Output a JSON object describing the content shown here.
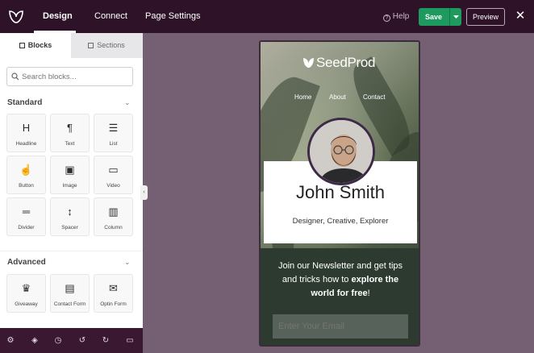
{
  "topbar": {
    "tabs": [
      "Design",
      "Connect",
      "Page Settings"
    ],
    "help_label": "Help",
    "save_label": "Save",
    "preview_label": "Preview",
    "close_glyph": "✕"
  },
  "sidebar": {
    "tabs": [
      "Blocks",
      "Sections"
    ],
    "search_placeholder": "Search blocks...",
    "standard_title": "Standard",
    "advanced_title": "Advanced",
    "standard_blocks": [
      {
        "label": "Headline",
        "icon": "headline-icon",
        "glyph": "H"
      },
      {
        "label": "Text",
        "icon": "paragraph-icon",
        "glyph": "¶"
      },
      {
        "label": "List",
        "icon": "list-icon",
        "glyph": "☰"
      },
      {
        "label": "Button",
        "icon": "pointer-icon",
        "glyph": "☝"
      },
      {
        "label": "Image",
        "icon": "image-icon",
        "glyph": "▣"
      },
      {
        "label": "Video",
        "icon": "video-icon",
        "glyph": "▭"
      },
      {
        "label": "Divider",
        "icon": "divider-icon",
        "glyph": "═"
      },
      {
        "label": "Spacer",
        "icon": "spacer-icon",
        "glyph": "↕"
      },
      {
        "label": "Column",
        "icon": "column-icon",
        "glyph": "▥"
      }
    ],
    "advanced_blocks": [
      {
        "label": "Giveaway",
        "icon": "giveaway-icon",
        "glyph": "♛"
      },
      {
        "label": "Contact Form",
        "icon": "contact-form-icon",
        "glyph": "▤"
      },
      {
        "label": "Optin Form",
        "icon": "mail-icon",
        "glyph": "✉"
      }
    ]
  },
  "bottombar": {
    "icons": [
      "settings-icon",
      "layers-icon",
      "history-icon",
      "undo-icon",
      "redo-icon",
      "desktop-icon"
    ]
  },
  "preview": {
    "brand": "SeedProd",
    "nav": [
      "Home",
      "About",
      "Contact"
    ],
    "name": "John Smith",
    "role": "Designer, Creative, Explorer",
    "newsletter_line1": "Join our Newsletter and get tips",
    "newsletter_line2": "and tricks how to ",
    "newsletter_bold1": "explore the",
    "newsletter_bold2": "world for free",
    "newsletter_end": "!",
    "email_placeholder": "Enter Your Email"
  },
  "colors": {
    "topbar": "#2e1328",
    "canvas": "#745f73",
    "save": "#1e9a5e",
    "newsletter_bg": "#2d3a2f"
  }
}
